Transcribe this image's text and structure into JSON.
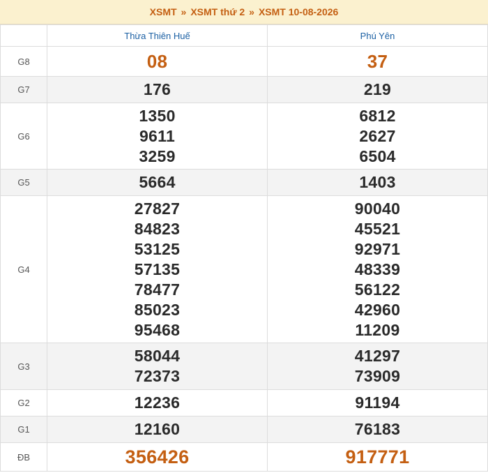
{
  "breadcrumb": {
    "items": [
      "XSMT",
      "XSMT thứ 2",
      "XSMT 10-08-2026"
    ],
    "separator": "»"
  },
  "provinces": [
    "Thừa Thiên Huế",
    "Phú Yên"
  ],
  "colors": {
    "accent": "#c45f12",
    "header_text": "#1a5fa3",
    "breadcrumb_bg": "#fbf1cf",
    "shaded_row": "#f3f3f3"
  },
  "prizes": [
    {
      "label": "G8",
      "values": [
        [
          "08"
        ],
        [
          "37"
        ]
      ]
    },
    {
      "label": "G7",
      "values": [
        [
          "176"
        ],
        [
          "219"
        ]
      ]
    },
    {
      "label": "G6",
      "values": [
        [
          "1350",
          "9611",
          "3259"
        ],
        [
          "6812",
          "2627",
          "6504"
        ]
      ]
    },
    {
      "label": "G5",
      "values": [
        [
          "5664"
        ],
        [
          "1403"
        ]
      ]
    },
    {
      "label": "G4",
      "values": [
        [
          "27827",
          "84823",
          "53125",
          "57135",
          "78477",
          "85023",
          "95468"
        ],
        [
          "90040",
          "45521",
          "92971",
          "48339",
          "56122",
          "42960",
          "11209"
        ]
      ]
    },
    {
      "label": "G3",
      "values": [
        [
          "58044",
          "72373"
        ],
        [
          "41297",
          "73909"
        ]
      ]
    },
    {
      "label": "G2",
      "values": [
        [
          "12236"
        ],
        [
          "91194"
        ]
      ]
    },
    {
      "label": "G1",
      "values": [
        [
          "12160"
        ],
        [
          "76183"
        ]
      ]
    },
    {
      "label": "ĐB",
      "values": [
        [
          "356426"
        ],
        [
          "917771"
        ]
      ]
    }
  ]
}
